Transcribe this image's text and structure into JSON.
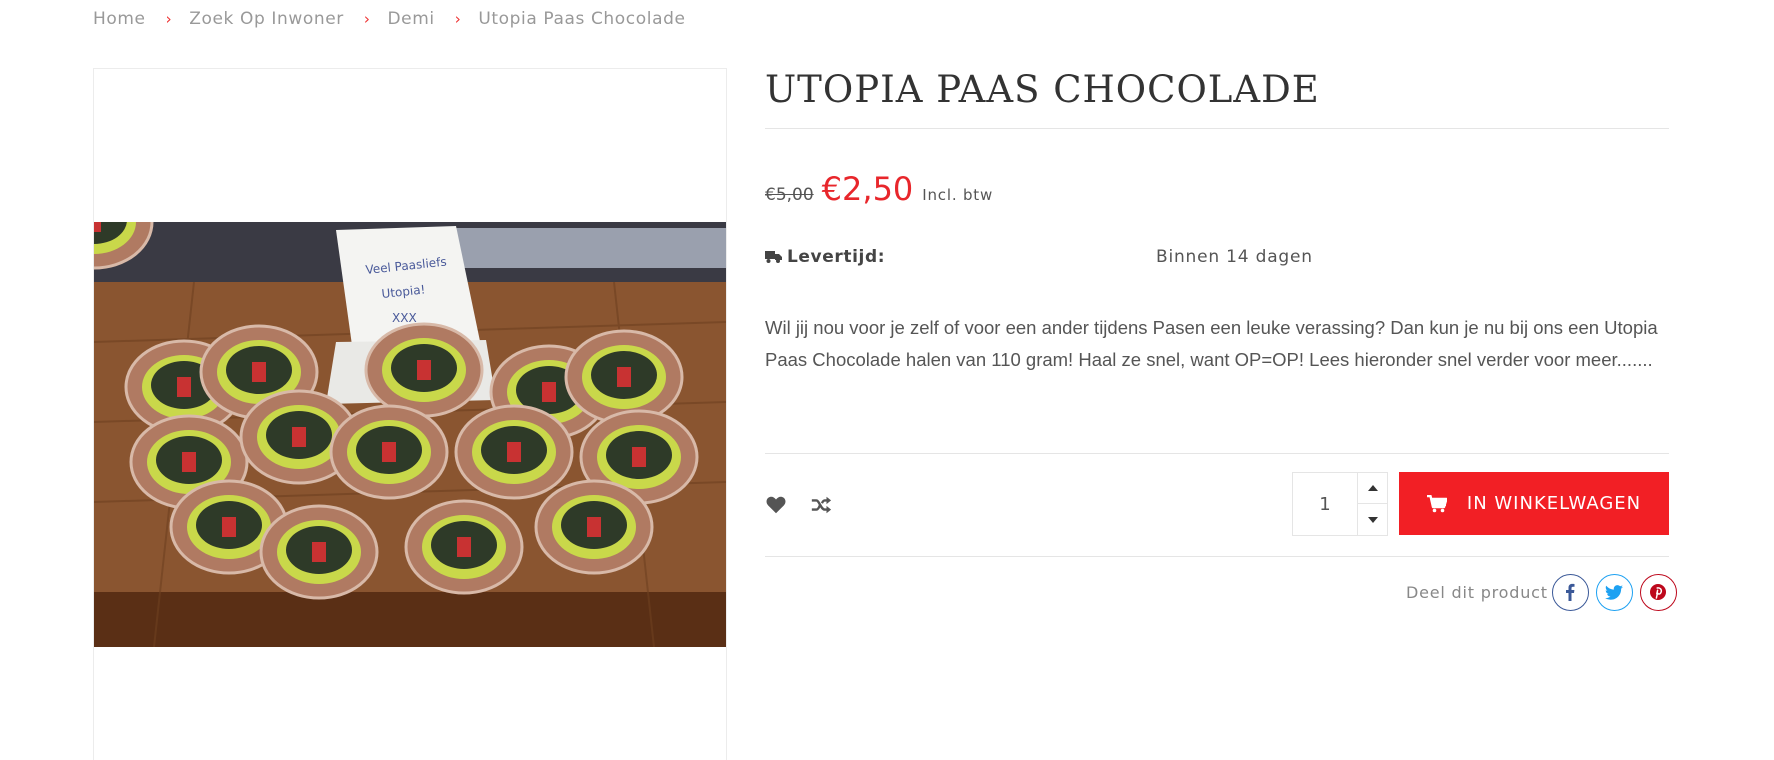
{
  "breadcrumb": {
    "items": [
      "Home",
      "Zoek Op Inwoner",
      "Demi",
      "Utopia Paas Chocolade"
    ],
    "separator": "›"
  },
  "product": {
    "title": "UTOPIA PAAS CHOCOLADE",
    "image_alt": "Utopia Paas Chocolade",
    "old_price": "€5,00",
    "new_price": "€2,50",
    "vat_note": "Incl. btw",
    "delivery_label": "Levertijd:",
    "delivery_value": "Binnen 14 dagen",
    "description": "Wil jij nou voor je zelf of voor een ander tijdens Pasen een leuke verassing? Dan kun je nu bij ons een Utopia Paas Chocolade halen van 110 gram! Haal ze snel, want OP=OP! Lees hieronder snel verder voor meer......."
  },
  "actions": {
    "wishlist_icon": "heart-icon",
    "compare_icon": "shuffle-icon",
    "quantity": "1",
    "add_to_cart": "IN WINKELWAGEN",
    "cart_icon": "shopping-cart-icon"
  },
  "share": {
    "label": "Deel dit product",
    "networks": [
      "facebook",
      "twitter",
      "pinterest"
    ]
  },
  "colors": {
    "accent": "#f21f25",
    "price": "#e8262b",
    "facebook": "#3b5998",
    "twitter": "#1da1f2",
    "pinterest": "#bd081c"
  }
}
